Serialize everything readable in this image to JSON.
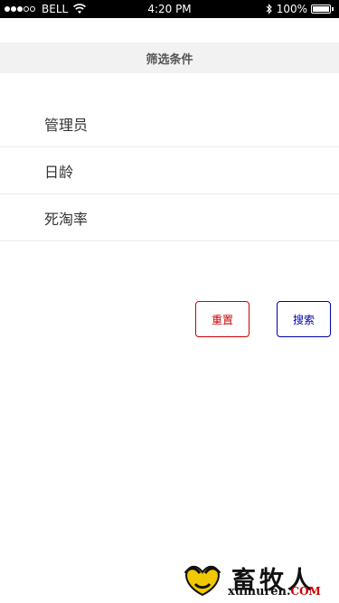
{
  "status_bar": {
    "carrier": "BELL",
    "time": "4:20 PM",
    "battery": "100%",
    "signal_bars_filled": 3,
    "signal_bars_total": 5
  },
  "header": {
    "title": "筛选条件"
  },
  "filters": [
    {
      "label": "管理员"
    },
    {
      "label": "日龄"
    },
    {
      "label": "死淘率"
    }
  ],
  "buttons": {
    "reset_label": "重置",
    "search_label": "搜索"
  },
  "watermark": {
    "name_cn": "畜牧人",
    "domain_main": "xumuren.",
    "domain_tld": "COM"
  },
  "colors": {
    "reset": "#cc0000",
    "search": "#0000aa",
    "header_bg": "#f2f2f2"
  }
}
